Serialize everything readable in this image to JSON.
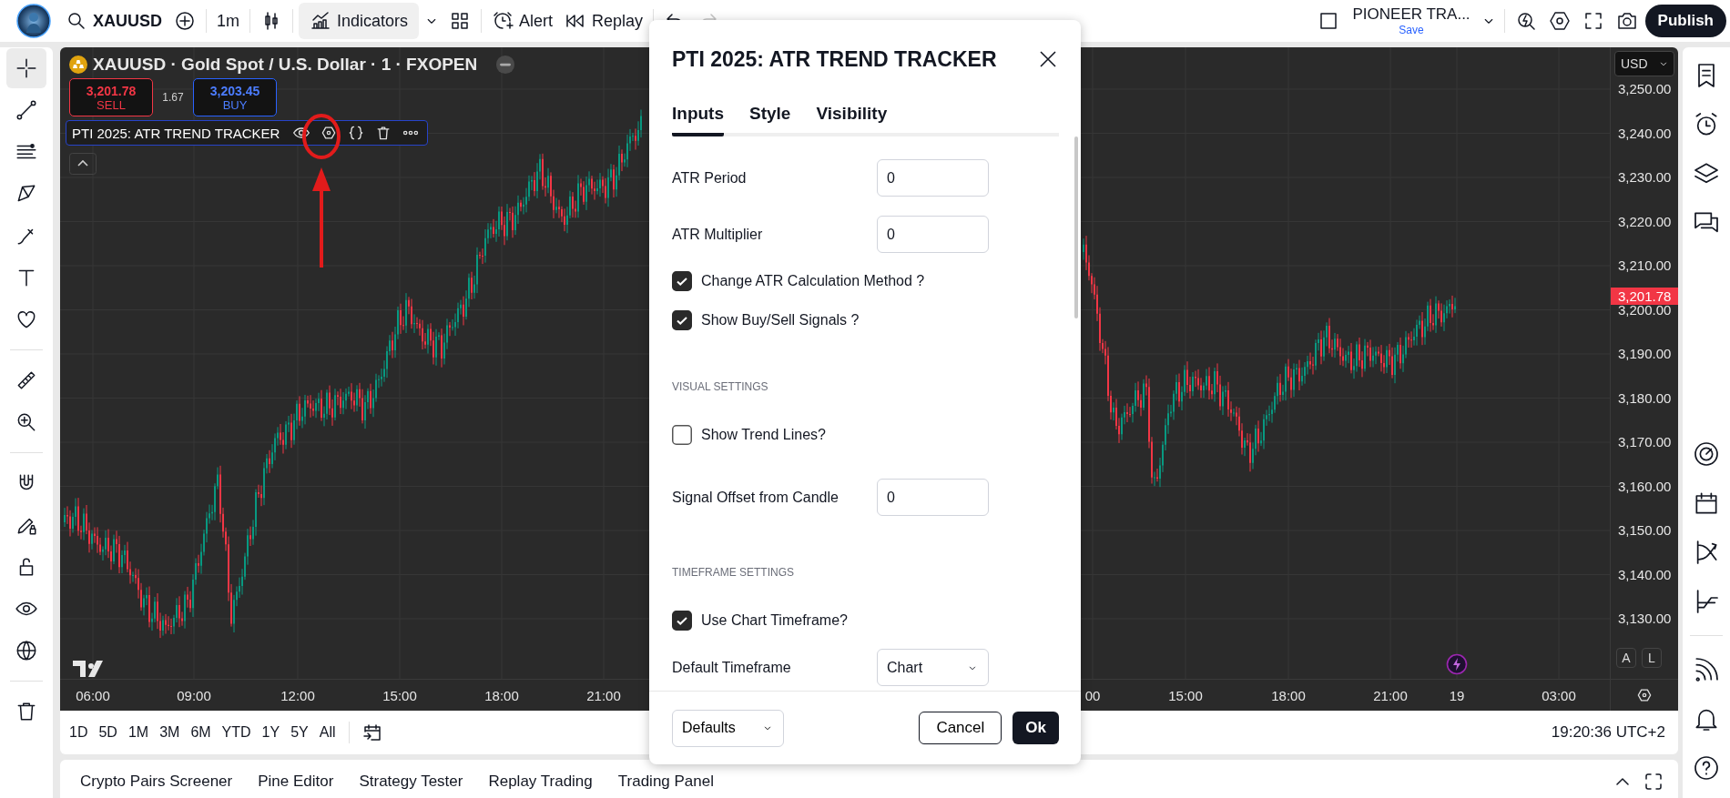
{
  "top_bar": {
    "symbol": "XAUUSD",
    "interval": "1m",
    "indicators": {
      "label": "Indicators",
      "selected": true
    },
    "alert": "Alert",
    "replay": "Replay",
    "redo": {
      "disabled": true
    },
    "layout": {
      "name": "PIONEER TRA...",
      "status": "Save"
    },
    "publish": "Publish"
  },
  "left_toolbar": [
    {
      "selected": true
    },
    {
      "selected": false
    },
    {
      "selected": false
    },
    {
      "selected": false
    },
    {
      "selected": false
    },
    {
      "selected": false
    },
    {
      "selected": false
    },
    {
      "selected": false
    },
    {
      "selected": false
    },
    {
      "selected": false
    },
    {
      "selected": false
    },
    {
      "selected": false
    },
    {
      "selected": false
    },
    {
      "selected": false
    },
    {
      "selected": false
    }
  ],
  "chart": {
    "legend": "XAUUSD · Gold Spot / U.S. Dollar · 1 · FXOPEN",
    "sell": {
      "price": "3,201.78",
      "label": "SELL"
    },
    "spread": "1.67",
    "buy": {
      "price": "3,203.45",
      "label": "BUY"
    },
    "indicator": "PTI 2025: ATR TREND TRACKER",
    "currency": "USD",
    "price_labels": [
      "3,250.00",
      "3,240.00",
      "3,230.00",
      "3,220.00",
      "3,210.00",
      "3,200.00",
      "3,190.00",
      "3,180.00",
      "3,170.00",
      "3,160.00",
      "3,150.00",
      "3,140.00",
      "3,130.00"
    ],
    "last_price": "3,201.78",
    "scale_buttons": [
      "A",
      "L"
    ],
    "time_labels": [
      "06:00",
      "09:00",
      "12:00",
      "15:00",
      "18:00",
      "21:00",
      "00",
      "15:00",
      "18:00",
      "21:00",
      "19",
      "03:00"
    ]
  },
  "range_bar": {
    "ranges": [
      "1D",
      "5D",
      "1M",
      "3M",
      "6M",
      "YTD",
      "1Y",
      "5Y",
      "All"
    ],
    "clock": "19:20:36 UTC+2"
  },
  "bottom_tabs": [
    "Crypto Pairs Screener",
    "Pine Editor",
    "Strategy Tester",
    "Replay Trading",
    "Trading Panel"
  ],
  "dialog": {
    "title": "PTI 2025: ATR TREND TRACKER",
    "tabs": [
      {
        "label": "Inputs",
        "selected": true
      },
      {
        "label": "Style",
        "selected": false
      },
      {
        "label": "Visibility",
        "selected": false
      }
    ],
    "inputs": [
      {
        "kind": "number",
        "label": "ATR Period",
        "value": "0"
      },
      {
        "kind": "number",
        "label": "ATR Multiplier",
        "value": "0"
      },
      {
        "kind": "checkbox",
        "label": "Change ATR Calculation Method ?",
        "checked": true
      },
      {
        "kind": "checkbox",
        "label": "Show Buy/Sell Signals ?",
        "checked": true
      },
      {
        "kind": "section",
        "label": "VISUAL SETTINGS"
      },
      {
        "kind": "checkbox",
        "label": "Show Trend Lines?",
        "checked": false
      },
      {
        "kind": "number",
        "label": "Signal Offset from Candle",
        "value": "0"
      },
      {
        "kind": "section",
        "label": "TIMEFRAME SETTINGS"
      },
      {
        "kind": "checkbox",
        "label": "Use Chart Timeframe?",
        "checked": true
      },
      {
        "kind": "select",
        "label": "Default Timeframe",
        "value": "Chart"
      }
    ],
    "defaults": "Defaults",
    "cancel": "Cancel",
    "ok": "Ok"
  }
}
